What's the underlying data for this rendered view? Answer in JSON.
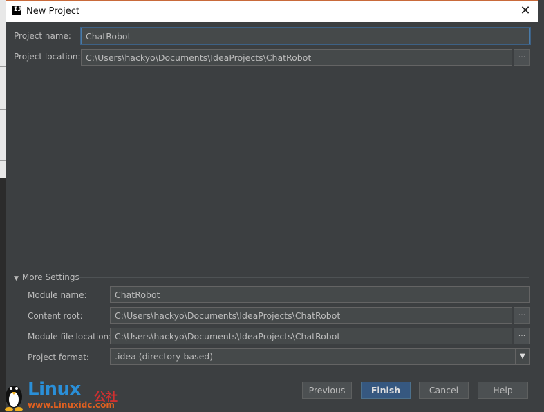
{
  "window": {
    "title": "New Project"
  },
  "form": {
    "project_name_label": "Project name:",
    "project_name_value": "ChatRobot",
    "project_location_label": "Project location:",
    "project_location_value": "C:\\Users\\hackyo\\Documents\\IdeaProjects\\ChatRobot"
  },
  "more_settings": {
    "label": "More Settings",
    "module_name_label": "Module name:",
    "module_name_value": "ChatRobot",
    "content_root_label": "Content root:",
    "content_root_value": "C:\\Users\\hackyo\\Documents\\IdeaProjects\\ChatRobot",
    "module_file_location_label": "Module file location:",
    "module_file_location_value": "C:\\Users\\hackyo\\Documents\\IdeaProjects\\ChatRobot",
    "project_format_label": "Project format:",
    "project_format_value": ".idea (directory based)"
  },
  "browse_label": "...",
  "buttons": {
    "previous": "Previous",
    "finish": "Finish",
    "cancel": "Cancel",
    "help": "Help"
  },
  "watermark": {
    "brand": "Linux",
    "brand_cn": "公社",
    "url": "www.Linuxidc.com"
  },
  "colors": {
    "dialog_bg": "#3c3f41",
    "field_bg": "#45494a",
    "focus_border": "#4a7ba8",
    "primary_button": "#365880",
    "dialog_border": "#c96a3a"
  }
}
